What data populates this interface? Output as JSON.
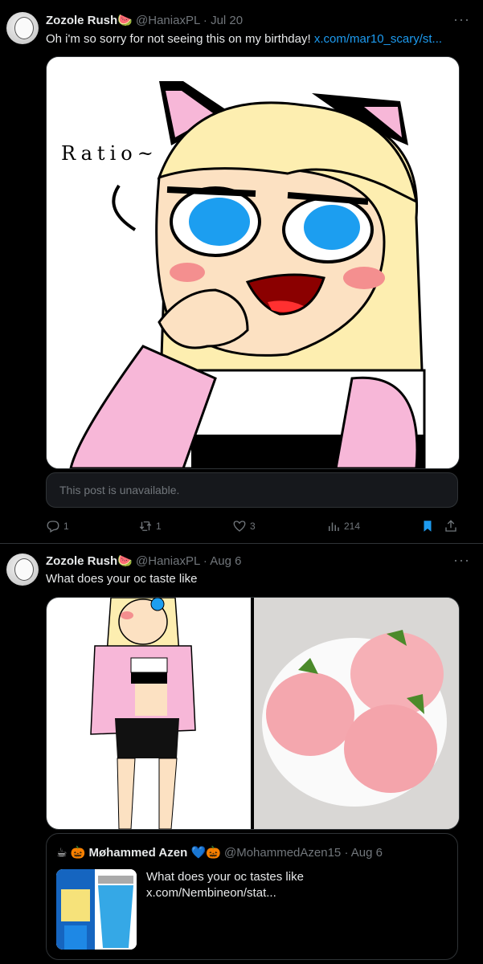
{
  "tweets": [
    {
      "author": "Zozole Rush",
      "emoji": "🍉",
      "handle": "@HaniaxPL",
      "dot": "·",
      "date": "Jul 20",
      "text": "Oh i'm so sorry for not seeing this on my birthday!",
      "link": "x.com/mar10_scary/st...",
      "more": "···",
      "drawing_caption": "Ratio~",
      "unavailable": "This post is unavailable.",
      "counts": {
        "replies": "1",
        "reposts": "1",
        "likes": "3",
        "views": "214"
      }
    },
    {
      "author": "Zozole Rush",
      "emoji": "🍉",
      "handle": "@HaniaxPL",
      "dot": "·",
      "date": "Aug 6",
      "text": "What does your oc taste like",
      "more": "···",
      "quote": {
        "prefix": "☕ 🎃",
        "author": "Møhammed Azen",
        "emoji": "💙🎃",
        "handle": "@MohammedAzen15",
        "dot": "·",
        "date": "Aug 6",
        "text": "What does your oc tastes like",
        "link": "x.com/Nembineon/stat..."
      }
    }
  ],
  "colors": {
    "background": "#000000",
    "link": "#1d9bf0",
    "muted": "#71767b",
    "bookmark": "#1d9bf0"
  },
  "icons": [
    "reply-icon",
    "repost-icon",
    "like-icon",
    "views-icon",
    "bookmark-icon",
    "share-icon",
    "more-icon"
  ]
}
